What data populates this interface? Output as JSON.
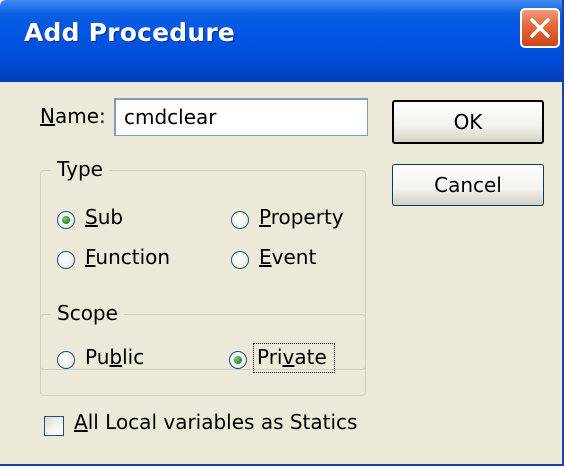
{
  "window": {
    "title": "Add Procedure",
    "close_icon": "close-x-icon",
    "colors": {
      "titlebar": "#0054e3",
      "close": "#e56a3f",
      "dialog_bg": "#ece9d8",
      "radio_dot": "#2a8a26"
    }
  },
  "name_field": {
    "label_mnemonic": "N",
    "label_rest": "ame:",
    "value": "cmdclear"
  },
  "buttons": {
    "ok": "OK",
    "cancel": "Cancel"
  },
  "type_group": {
    "legend": "Type",
    "options": [
      {
        "pre": "",
        "mnemonic": "S",
        "post": "ub",
        "selected": true
      },
      {
        "pre": "",
        "mnemonic": "P",
        "post": "roperty",
        "selected": false
      },
      {
        "pre": "",
        "mnemonic": "F",
        "post": "unction",
        "selected": false
      },
      {
        "pre": "",
        "mnemonic": "E",
        "post": "vent",
        "selected": false
      }
    ]
  },
  "scope_group": {
    "legend": "Scope",
    "options": [
      {
        "pre": "Pu",
        "mnemonic": "b",
        "post": "lic",
        "selected": false
      },
      {
        "pre": "Pri",
        "mnemonic": "v",
        "post": "ate",
        "selected": true,
        "focused": true
      }
    ]
  },
  "statics_checkbox": {
    "mnemonic": "A",
    "post": "ll Local variables as Statics",
    "checked": false
  }
}
